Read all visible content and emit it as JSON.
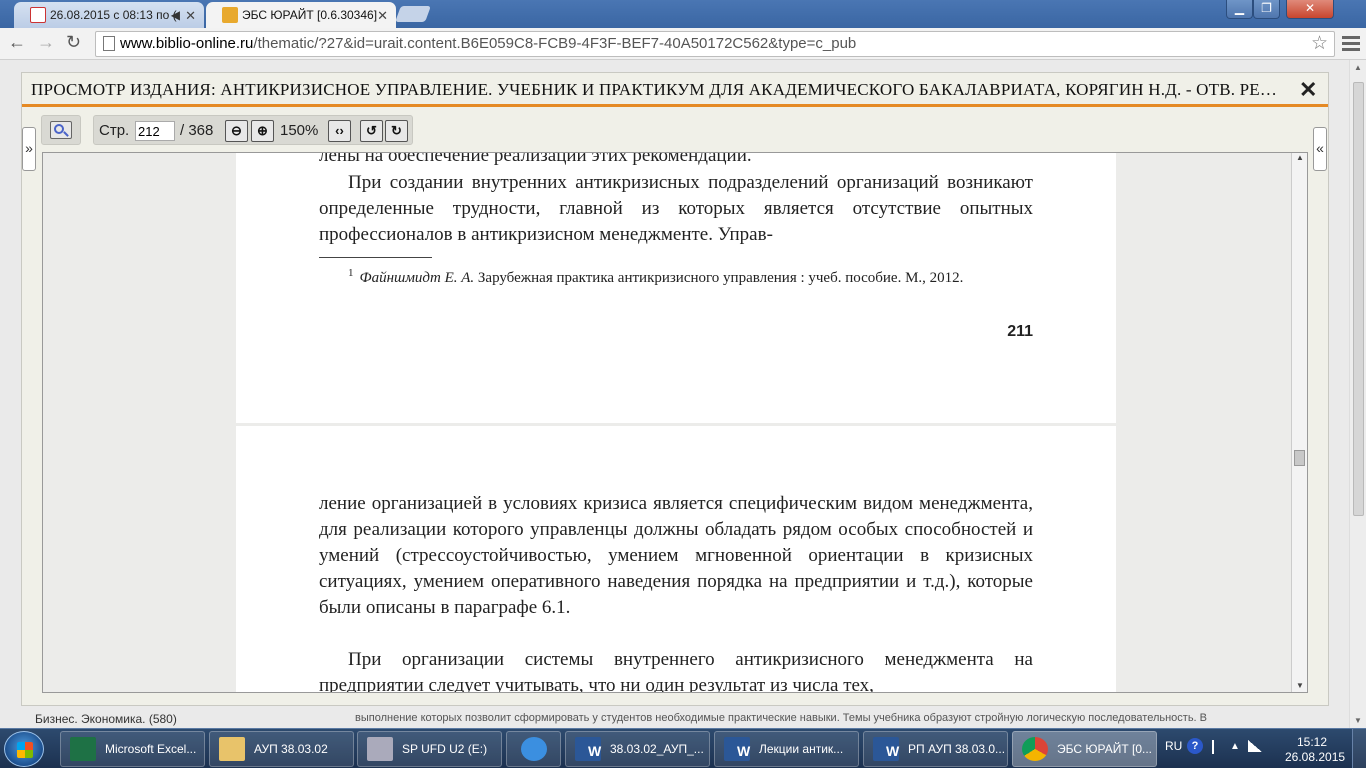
{
  "browser": {
    "tabs": [
      {
        "label": "26.08.2015 с 08:13 по (",
        "active": false
      },
      {
        "label": "ЭБС ЮРАЙТ [0.6.30346]",
        "active": true
      }
    ],
    "url_host": "www.biblio-online.ru",
    "url_rest": "/thematic/?27&id=urait.content.B6E059C8-FCB9-4F3F-BEF7-40A50172C562&type=c_pub",
    "icons": {
      "back": "back-arrow-icon",
      "forward": "forward-arrow-icon",
      "reload": "reload-icon",
      "star": "star-icon",
      "menu": "menu-icon"
    }
  },
  "viewer": {
    "title": "ПРОСМОТР ИЗДАНИЯ: АНТИКРИЗИСНОЕ УПРАВЛЕНИЕ. УЧЕБНИК И ПРАКТИКУМ ДЛЯ АКАДЕМИЧЕСКОГО БАКАЛАВРИАТА, КОРЯГИН Н.Д. - ОТВ. РЕДАКТОР",
    "close": "✕",
    "page_label": "Стр.",
    "page_current": "212",
    "page_total": "/ 368",
    "zoom": "150%",
    "left_toggle": "»",
    "right_toggle": "«",
    "accent_color": "#e58a24"
  },
  "document": {
    "page1": {
      "lead_fragment": "лены на обеспечение реализации этих рекомендации.",
      "paragraph": "При создании внутренних антикризисных подразделений организаций возникают определенные трудности, главной из которых является отсутствие опытных профессионалов в антикризисном менеджменте. Управ-",
      "footnote_mark": "1",
      "footnote_author": "Файншмидт Е. А.",
      "footnote_text": "Зарубежная практика антикризисного управления : учеб. пособие. М., 2012.",
      "page_number": "211"
    },
    "page2": {
      "paragraph1": "ление организацией в условиях кризиса является специфическим видом менеджмента, для реализации которого управленцы должны обладать рядом особых способностей и умений (стрессоустойчивостью, умением мгновенной ориентации в кризисных ситуациях, умением оперативного наведения порядка на предприятии и т.д.), которые были описаны в параграфе 6.1.",
      "paragraph2": "При организации системы внутреннего антикризисного менеджмента на предприятии следует учитывать, что ни один результат из числа тех,"
    }
  },
  "background_text": {
    "left": "Бизнес. Экономика. (580)",
    "right": "выполнение которых позволит сформировать у студентов необходимые практические навыки. Темы учебника образуют стройную логическую последовательность. В"
  },
  "taskbar": {
    "items": [
      {
        "label": "Microsoft Excel..."
      },
      {
        "label": "АУП 38.03.02"
      },
      {
        "label": "SP UFD U2 (E:)"
      },
      {
        "label": ""
      },
      {
        "label": "38.03.02_АУП_..."
      },
      {
        "label": "Лекции антик..."
      },
      {
        "label": "РП АУП 38.03.0..."
      },
      {
        "label": "ЭБС ЮРАЙТ [0..."
      }
    ],
    "lang": "RU",
    "time": "15:12",
    "date": "26.08.2015"
  }
}
